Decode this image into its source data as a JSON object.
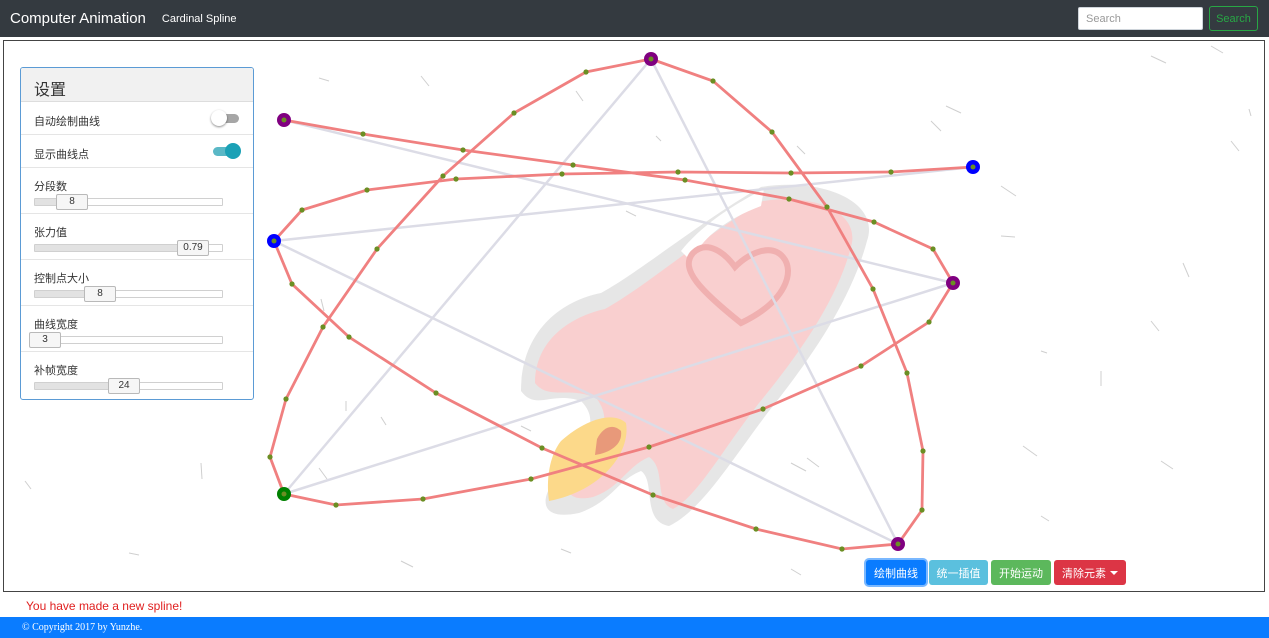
{
  "navbar": {
    "brand": "Computer Animation",
    "link": "Cardinal Spline",
    "search_placeholder": "Search",
    "search_button": "Search"
  },
  "settings": {
    "title": "设置",
    "auto_draw": {
      "label": "自动绘制曲线",
      "on": false
    },
    "show_points": {
      "label": "显示曲线点",
      "on": true
    },
    "segments": {
      "label": "分段数",
      "value": "8"
    },
    "tension": {
      "label": "张力值",
      "value": "0.79"
    },
    "point_size": {
      "label": "控制点大小",
      "value": "8"
    },
    "curve_width": {
      "label": "曲线宽度",
      "value": "3"
    },
    "frame_width": {
      "label": "补帧宽度",
      "value": "24"
    }
  },
  "buttons": {
    "draw": "绘制曲线",
    "interpolate": "统一插值",
    "animate": "开始运动",
    "clear": "清除元素"
  },
  "message": "You have made a new spline!",
  "footer": "© Copyright 2017 by Yunzhe.",
  "colors": {
    "navbar": "#343a40",
    "curve": "#f08080",
    "control_polygon": "#d8d8e4",
    "curve_point": "#6b8e23",
    "control_point_purple": "#800080",
    "control_point_blue": "#0000ff",
    "control_point_green": "#008000",
    "primary": "#0a7cff",
    "danger": "#dc3545"
  }
}
